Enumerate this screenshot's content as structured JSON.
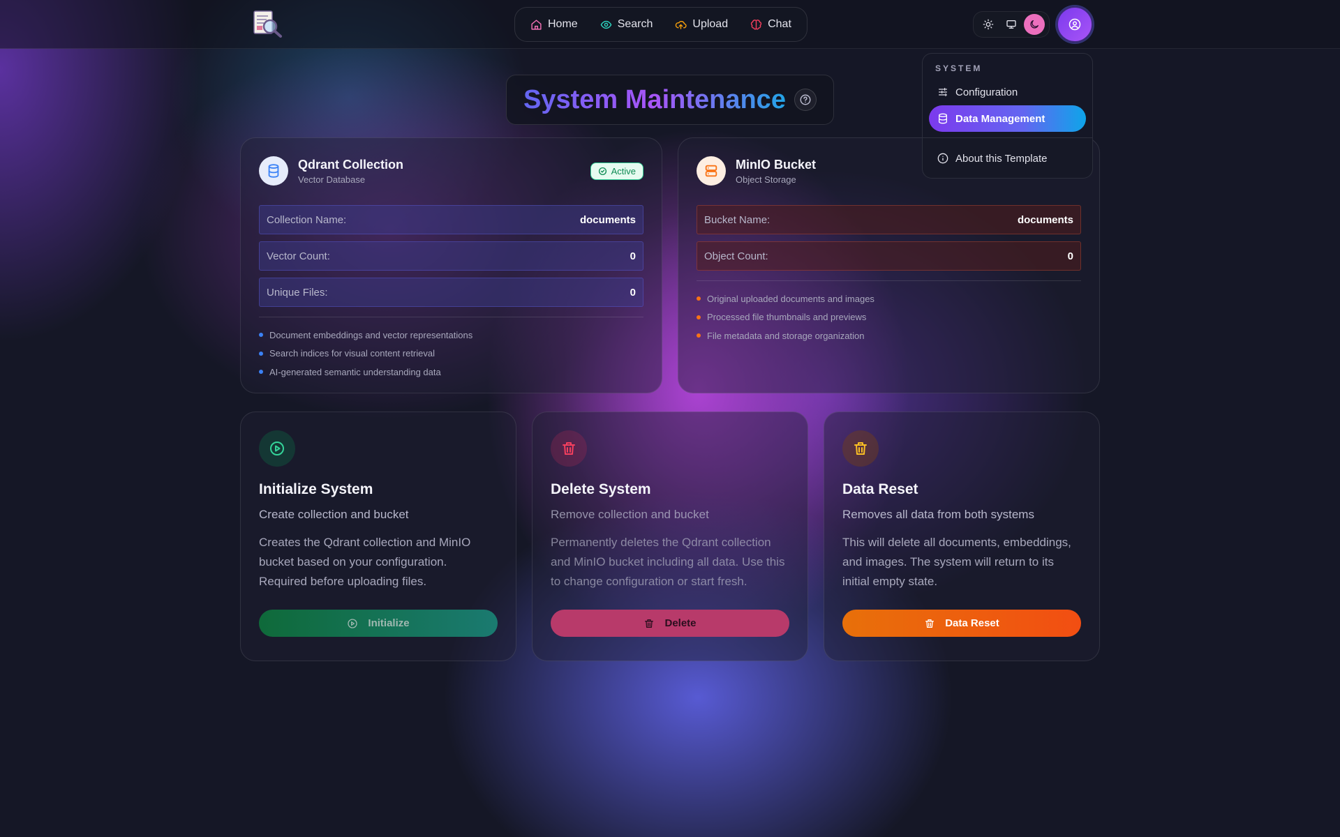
{
  "nav": {
    "items": [
      {
        "label": "Home",
        "icon": "home-icon",
        "color": "#f472b6"
      },
      {
        "label": "Search",
        "icon": "eye-icon",
        "color": "#2dd4bf"
      },
      {
        "label": "Upload",
        "icon": "cloud-upload-icon",
        "color": "#f59e0b"
      },
      {
        "label": "Chat",
        "icon": "brain-icon",
        "color": "#f43f5e"
      }
    ]
  },
  "theme": {
    "active": "dark",
    "options": [
      "light",
      "system",
      "dark"
    ]
  },
  "dropdown": {
    "section": "SYSTEM",
    "items": [
      {
        "label": "Configuration",
        "icon": "sliders-icon"
      },
      {
        "label": "Data Management",
        "icon": "database-icon",
        "active": true
      },
      {
        "label": "About this Template",
        "icon": "info-icon"
      }
    ]
  },
  "page": {
    "title": "System Maintenance"
  },
  "qdrant": {
    "title": "Qdrant Collection",
    "subtitle": "Vector Database",
    "status": "Active",
    "fields": [
      {
        "label": "Collection Name:",
        "value": "documents"
      },
      {
        "label": "Vector Count:",
        "value": "0"
      },
      {
        "label": "Unique Files:",
        "value": "0"
      }
    ],
    "bullets": [
      "Document embeddings and vector representations",
      "Search indices for visual content retrieval",
      "AI-generated semantic understanding data"
    ],
    "accent": "#3b82f6"
  },
  "minio": {
    "title": "MinIO Bucket",
    "subtitle": "Object Storage",
    "fields": [
      {
        "label": "Bucket Name:",
        "value": "documents"
      },
      {
        "label": "Object Count:",
        "value": "0"
      }
    ],
    "bullets": [
      "Original uploaded documents and images",
      "Processed file thumbnails and previews",
      "File metadata and storage organization"
    ],
    "accent": "#f97316"
  },
  "actions": [
    {
      "title": "Initialize System",
      "subtitle": "Create collection and bucket",
      "description": "Creates the Qdrant collection and MinIO bucket based on your configuration. Required before uploading files.",
      "button": "Initialize",
      "icon": "play-circle-icon"
    },
    {
      "title": "Delete System",
      "subtitle": "Remove collection and bucket",
      "description": "Permanently deletes the Qdrant collection and MinIO bucket including all data. Use this to change configuration or start fresh.",
      "button": "Delete",
      "icon": "trash-icon"
    },
    {
      "title": "Data Reset",
      "subtitle": "Removes all data from both systems",
      "description": "This will delete all documents, embeddings, and images. The system will return to its initial empty state.",
      "button": "Data Reset",
      "icon": "trash-icon"
    }
  ]
}
